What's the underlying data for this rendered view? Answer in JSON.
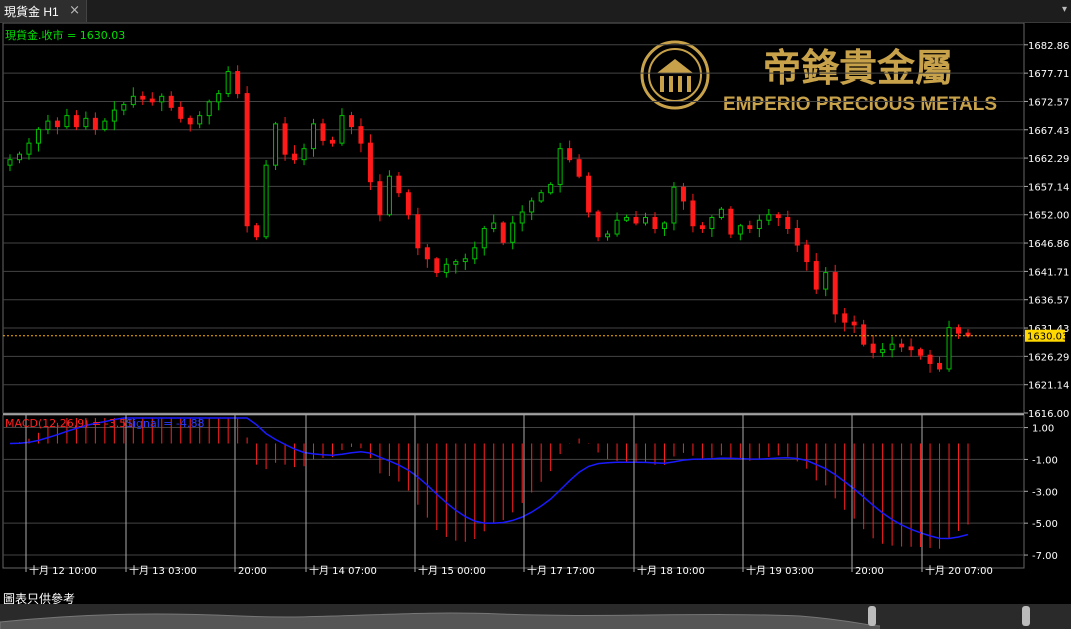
{
  "tab": {
    "title": "現貨金 H1",
    "close": "×",
    "menu": "▾"
  },
  "price_label": "現貨金.收市 = 1630.03",
  "macd_label": "MACD(12,26,9) = -3.51",
  "signal_label": "Signal = -4.88",
  "current_price_tag": "1630.03",
  "disclaimer": "圖表只供參考",
  "brand": {
    "name_cn": "帝鋒貴金屬",
    "name_en": "EMPERIO PRECIOUS METALS"
  },
  "colors": {
    "up": "#00c000",
    "down": "#ff1a1a",
    "signal": "#1a1aff",
    "gold": "#c8a24a",
    "bg": "#000000"
  },
  "chart_data": [
    {
      "type": "candlestick",
      "title": "現貨金 H1",
      "ylim": [
        1616.0,
        1685.0
      ],
      "y_ticks": [
        1682.86,
        1677.71,
        1672.57,
        1667.43,
        1662.29,
        1657.14,
        1652.0,
        1646.86,
        1641.71,
        1636.57,
        1631.43,
        1626.29,
        1621.14,
        1616.0
      ],
      "x_ticks": [
        "十月 12 10:00",
        "十月 13 03:00",
        "20:00",
        "十月 14 07:00",
        "十月 15 00:00",
        "十月 17 17:00",
        "十月 18 10:00",
        "十月 19 03:00",
        "20:00",
        "十月 20 07:00"
      ],
      "close_series": [
        1662.0,
        1663.0,
        1665.0,
        1667.5,
        1669.0,
        1668.0,
        1670.0,
        1668.0,
        1669.5,
        1667.5,
        1669.0,
        1671.0,
        1672.0,
        1673.5,
        1673.0,
        1672.5,
        1673.5,
        1671.5,
        1669.5,
        1668.5,
        1670.0,
        1672.5,
        1674.0,
        1678.0,
        1674.0,
        1650.0,
        1648.0,
        1661.0,
        1668.5,
        1663.0,
        1662.0,
        1664.0,
        1668.5,
        1665.5,
        1665.0,
        1670.0,
        1668.0,
        1665.0,
        1658.0,
        1652.0,
        1659.0,
        1656.0,
        1652.0,
        1646.0,
        1644.0,
        1641.5,
        1643.0,
        1643.5,
        1644.0,
        1646.0,
        1649.5,
        1650.5,
        1647.0,
        1650.5,
        1652.5,
        1654.5,
        1656.0,
        1657.5,
        1664.0,
        1662.0,
        1659.0,
        1652.5,
        1648.0,
        1648.5,
        1651.0,
        1651.5,
        1650.5,
        1651.5,
        1649.5,
        1650.5,
        1657.0,
        1654.5,
        1650.0,
        1649.5,
        1651.5,
        1653.0,
        1648.5,
        1650.0,
        1649.5,
        1651.0,
        1652.0,
        1651.5,
        1649.5,
        1646.5,
        1643.5,
        1638.5,
        1641.5,
        1634.0,
        1632.5,
        1632.0,
        1628.5,
        1627.0,
        1627.5,
        1628.5,
        1628.0,
        1627.5,
        1626.5,
        1625.0,
        1624.0,
        1631.5,
        1630.5,
        1630.03
      ],
      "series": [
        {
          "name": "MACD(12,26,9)",
          "last": -3.51
        },
        {
          "name": "Signal",
          "last": -4.88
        }
      ],
      "macd_ylim": [
        -7.5,
        1.6
      ],
      "macd_y_ticks": [
        1.0,
        -1.0,
        -3.0,
        -5.0,
        -7.0
      ],
      "last_close": 1630.03
    }
  ]
}
